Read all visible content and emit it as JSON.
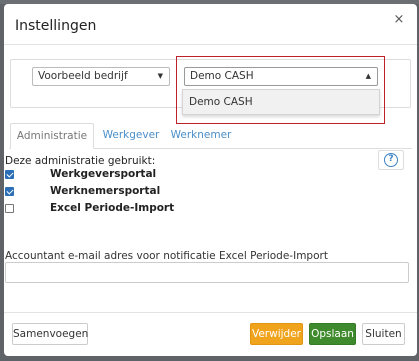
{
  "dialog": {
    "title": "Instellingen",
    "close_symbol": "×"
  },
  "company_select": {
    "value": "Voorbeeld bedrijf",
    "caret": "▼"
  },
  "cash_select": {
    "value": "Demo CASH",
    "caret": "▲",
    "options": [
      "Demo CASH"
    ]
  },
  "tabs": [
    {
      "label": "Administratie"
    },
    {
      "label": "Werkgever"
    },
    {
      "label": "Werknemer"
    }
  ],
  "help": {
    "symbol": "?"
  },
  "uses_label": "Deze administratie gebruikt:",
  "options": [
    {
      "label": "Werkgeversportal",
      "checked": true
    },
    {
      "label": "Werknemersportal",
      "checked": true
    },
    {
      "label": "Excel Periode-Import",
      "checked": false
    }
  ],
  "email": {
    "label": "Accountant e-mail adres voor notificatie Excel Periode-Import",
    "value": ""
  },
  "footer": {
    "merge": "Samenvoegen",
    "delete": "Verwijder",
    "save": "Opslaan",
    "close": "Sluiten"
  },
  "colors": {
    "delete_button": "#f0a31c",
    "save_button": "#3e8a2c",
    "highlight_border": "#c0202a",
    "link_tab": "#4a8ec8",
    "checkbox_checked": "#2d6fb6"
  }
}
